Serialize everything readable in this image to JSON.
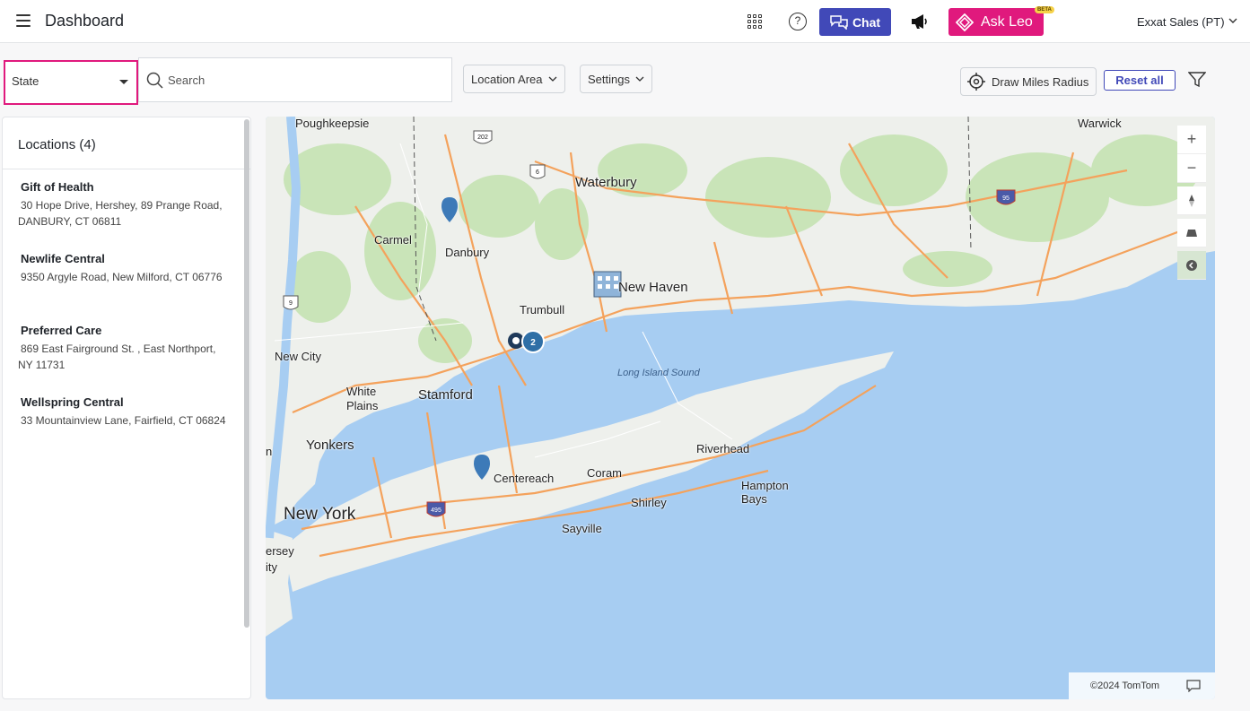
{
  "header": {
    "title": "Dashboard",
    "chat_label": "Chat",
    "ask_leo_label": "Ask Leo",
    "beta_label": "BETA",
    "org_name": "Exxat Sales (PT)"
  },
  "filters": {
    "state_label": "State",
    "search_placeholder": "Search",
    "location_area_label": "Location Area",
    "settings_label": "Settings",
    "draw_radius_label": "Draw Miles Radius",
    "reset_label": "Reset all"
  },
  "locations": {
    "header": "Locations (4)",
    "items": [
      {
        "name": "Gift of Health",
        "address": "30 Hope Drive, Hershey, 89 Prange Road, DANBURY, CT 06811"
      },
      {
        "name": "Newlife Central",
        "address": "9350 Argyle Road, New Milford, CT 06776"
      },
      {
        "name": "Preferred Care",
        "address": "869 East Fairground St. , East Northport, NY 11731"
      },
      {
        "name": "Wellspring Central",
        "address": "33 Mountainview Lane, Fairfield, CT 06824"
      }
    ]
  },
  "map": {
    "places": [
      "Poughkeepsie",
      "Waterbury",
      "Warwick",
      "Carmel",
      "Danbury",
      "New Haven",
      "Trumbull",
      "New City",
      "White",
      "Plains",
      "Stamford",
      "Yonkers",
      "New York",
      "Riverhead",
      "Coram",
      "Centereach",
      "Hampton",
      "Bays",
      "Shirley",
      "Sayville",
      "ersey",
      "ity",
      "n"
    ],
    "water_label": "Long Island Sound",
    "route_shields": [
      "202",
      "6",
      "9",
      "95",
      "495"
    ],
    "cluster_count": "2",
    "attribution": "©2024 TomTom",
    "controls": [
      "zoom-in",
      "zoom-out",
      "compass",
      "pitch",
      "style"
    ]
  },
  "colors": {
    "accent": "#4149b8",
    "brand_pink": "#e0197d",
    "water": "#a7cdf2",
    "land": "#eef0ec",
    "road": "#f4a25c",
    "green": "#c9e4b8"
  }
}
